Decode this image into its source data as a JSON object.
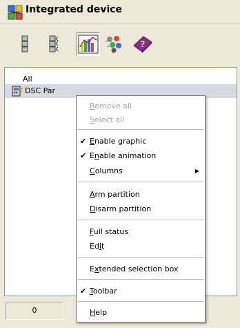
{
  "window": {
    "title": "Integrated device"
  },
  "toolbar": {
    "buttons": [
      {
        "name": "list-view-icon",
        "pressed": false
      },
      {
        "name": "details-view-icon",
        "pressed": false
      },
      {
        "name": "graphic-chart-icon",
        "pressed": true
      },
      {
        "name": "animation-icon",
        "pressed": false
      },
      {
        "name": "help-book-icon",
        "pressed": false
      }
    ]
  },
  "device_list": {
    "items": [
      {
        "label": "All"
      },
      {
        "label": "DSC Par"
      }
    ]
  },
  "status_bar": {
    "count": "0"
  },
  "context_menu": {
    "items": [
      {
        "pre": "",
        "key": "R",
        "post": "emove all",
        "enabled": false,
        "checked": false
      },
      {
        "pre": "",
        "key": "S",
        "post": "elect all",
        "enabled": false,
        "checked": false
      },
      {
        "pre": "",
        "key": "E",
        "post": "nable graphic",
        "enabled": true,
        "checked": true
      },
      {
        "pre": "E",
        "key": "n",
        "post": "able animation",
        "enabled": true,
        "checked": true
      },
      {
        "pre": "",
        "key": "C",
        "post": "olumns",
        "enabled": true,
        "checked": false,
        "submenu": true
      },
      {
        "pre": "",
        "key": "A",
        "post": "rm partition",
        "enabled": true,
        "checked": false
      },
      {
        "pre": "",
        "key": "D",
        "post": "isarm partition",
        "enabled": true,
        "checked": false
      },
      {
        "pre": "",
        "key": "F",
        "post": "ull status",
        "enabled": true,
        "checked": false
      },
      {
        "pre": "Ed",
        "key": "i",
        "post": "t",
        "enabled": true,
        "checked": false
      },
      {
        "pre": "E",
        "key": "x",
        "post": "tended selection box",
        "enabled": true,
        "checked": false
      },
      {
        "pre": "",
        "key": "T",
        "post": "oolbar",
        "enabled": true,
        "checked": true
      },
      {
        "pre": "",
        "key": "H",
        "post": "elp",
        "enabled": true,
        "checked": false
      }
    ]
  },
  "colors": {
    "window_bg": "#ece9d8",
    "list_bg": "#ffffff",
    "disabled_text": "#a7a6aa",
    "selection_row": "#d8d8e0"
  }
}
